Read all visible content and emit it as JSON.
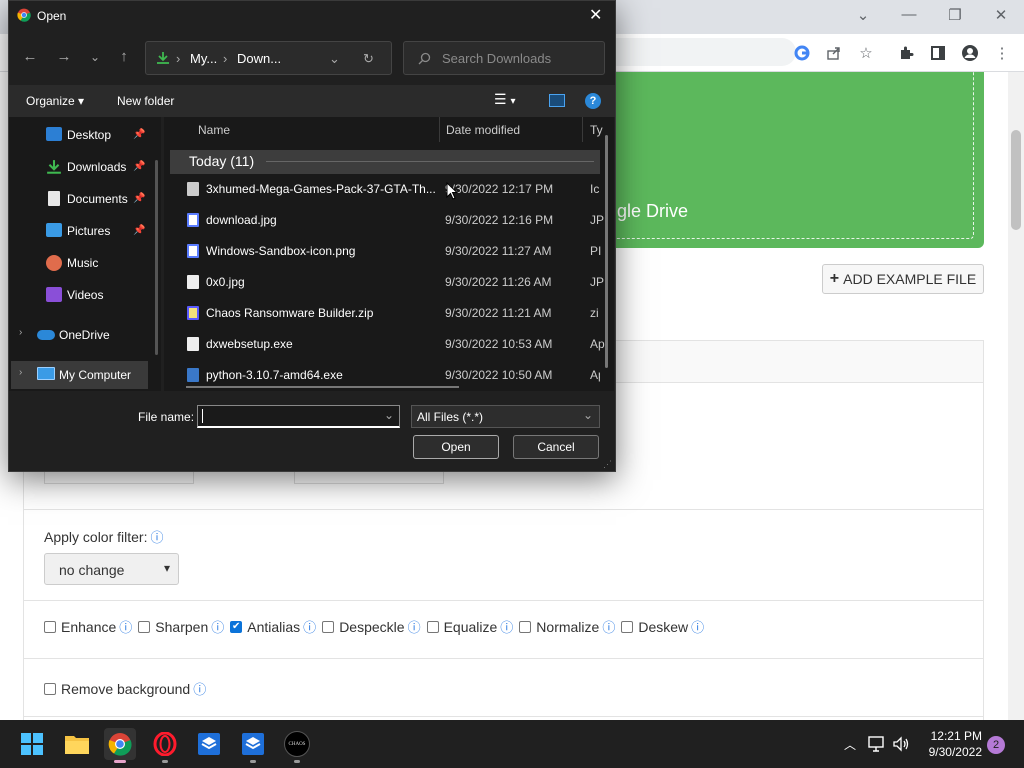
{
  "browser": {
    "window_controls": {
      "chevron": "⌄",
      "minimize": "—",
      "restore": "❐",
      "close": "✕"
    },
    "toolbar_icons": [
      "google-icon",
      "share-icon",
      "star-icon",
      "extensions-icon",
      "sidebar-icon",
      "profile-icon",
      "menu-icon"
    ]
  },
  "page": {
    "dropzone_text": "gle Drive",
    "add_example_label": "ADD EXAMPLE FILE",
    "color_filter": {
      "label": "Apply color filter:",
      "selected": "no change"
    },
    "options": [
      {
        "label": "Enhance",
        "checked": false
      },
      {
        "label": "Sharpen",
        "checked": false
      },
      {
        "label": "Antialias",
        "checked": true
      },
      {
        "label": "Despeckle",
        "checked": false
      },
      {
        "label": "Equalize",
        "checked": false
      },
      {
        "label": "Normalize",
        "checked": false
      },
      {
        "label": "Deskew",
        "checked": false
      }
    ],
    "remove_background": {
      "label": "Remove background",
      "checked": false
    },
    "info_glyph": "ⓘ"
  },
  "dialog": {
    "title": "Open",
    "address": {
      "crumb1": "My...",
      "sep": "›",
      "crumb2": "Down..."
    },
    "search_placeholder": "Search Downloads",
    "organize_label": "Organize",
    "new_folder_label": "New folder",
    "nav": [
      {
        "label": "Desktop",
        "icon": "desktop-icon",
        "pinned": true
      },
      {
        "label": "Downloads",
        "icon": "download-icon",
        "pinned": true
      },
      {
        "label": "Documents",
        "icon": "documents-icon",
        "pinned": true
      },
      {
        "label": "Pictures",
        "icon": "pictures-icon",
        "pinned": true
      },
      {
        "label": "Music",
        "icon": "music-icon",
        "pinned": false
      },
      {
        "label": "Videos",
        "icon": "videos-icon",
        "pinned": false
      },
      {
        "label": "OneDrive",
        "icon": "onedrive-icon",
        "pinned": false
      },
      {
        "label": "My Computer",
        "icon": "computer-icon",
        "pinned": false
      }
    ],
    "columns": {
      "name": "Name",
      "date": "Date modified",
      "type": "Ty"
    },
    "group_label": "Today (11)",
    "files": [
      {
        "name": "3xhumed-Mega-Games-Pack-37-GTA-Th...",
        "date": "9/30/2022 12:17 PM",
        "type": "Ic"
      },
      {
        "name": "download.jpg",
        "date": "9/30/2022 12:16 PM",
        "type": "JP"
      },
      {
        "name": "Windows-Sandbox-icon.png",
        "date": "9/30/2022 11:27 AM",
        "type": "PI"
      },
      {
        "name": "0x0.jpg",
        "date": "9/30/2022 11:26 AM",
        "type": "JP"
      },
      {
        "name": "Chaos Ransomware Builder.zip",
        "date": "9/30/2022 11:21 AM",
        "type": "zi"
      },
      {
        "name": "dxwebsetup.exe",
        "date": "9/30/2022 10:53 AM",
        "type": "Ap"
      },
      {
        "name": "python-3.10.7-amd64.exe",
        "date": "9/30/2022 10:50 AM",
        "type": "Ap"
      }
    ],
    "file_name_label": "File name:",
    "file_name_value": "",
    "file_type": "All Files (*.*)",
    "open_label": "Open",
    "cancel_label": "Cancel"
  },
  "taskbar": {
    "time": "12:21 PM",
    "date": "9/30/2022",
    "notification_count": "2",
    "chaos_label": "CHAOS"
  },
  "colors": {
    "accent_green": "#5cb85c",
    "taskbar": "#202020",
    "dialog_bg": "#202020",
    "link_blue": "#2a7ae2"
  }
}
